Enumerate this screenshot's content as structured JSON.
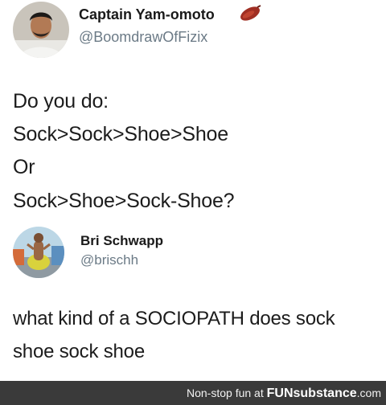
{
  "tweet": {
    "display_name": "Captain Yam-omoto",
    "handle": "@BoomdrawOfFizix",
    "lines": [
      "Do you do:",
      "Sock>Sock>Shoe>Shoe",
      "Or",
      "Sock>Shoe>Sock-Shoe?"
    ]
  },
  "reply": {
    "display_name": "Bri Schwapp",
    "handle": "@brischh",
    "lines": [
      "what kind of a SOCIOPATH does sock",
      "shoe sock shoe"
    ]
  },
  "footer": {
    "prefix": "Non-stop fun at ",
    "brand_bold": "FUNsubstance",
    "brand_suffix": ".com"
  },
  "icons": {
    "yam": "sweet-potato-emoji-icon"
  }
}
